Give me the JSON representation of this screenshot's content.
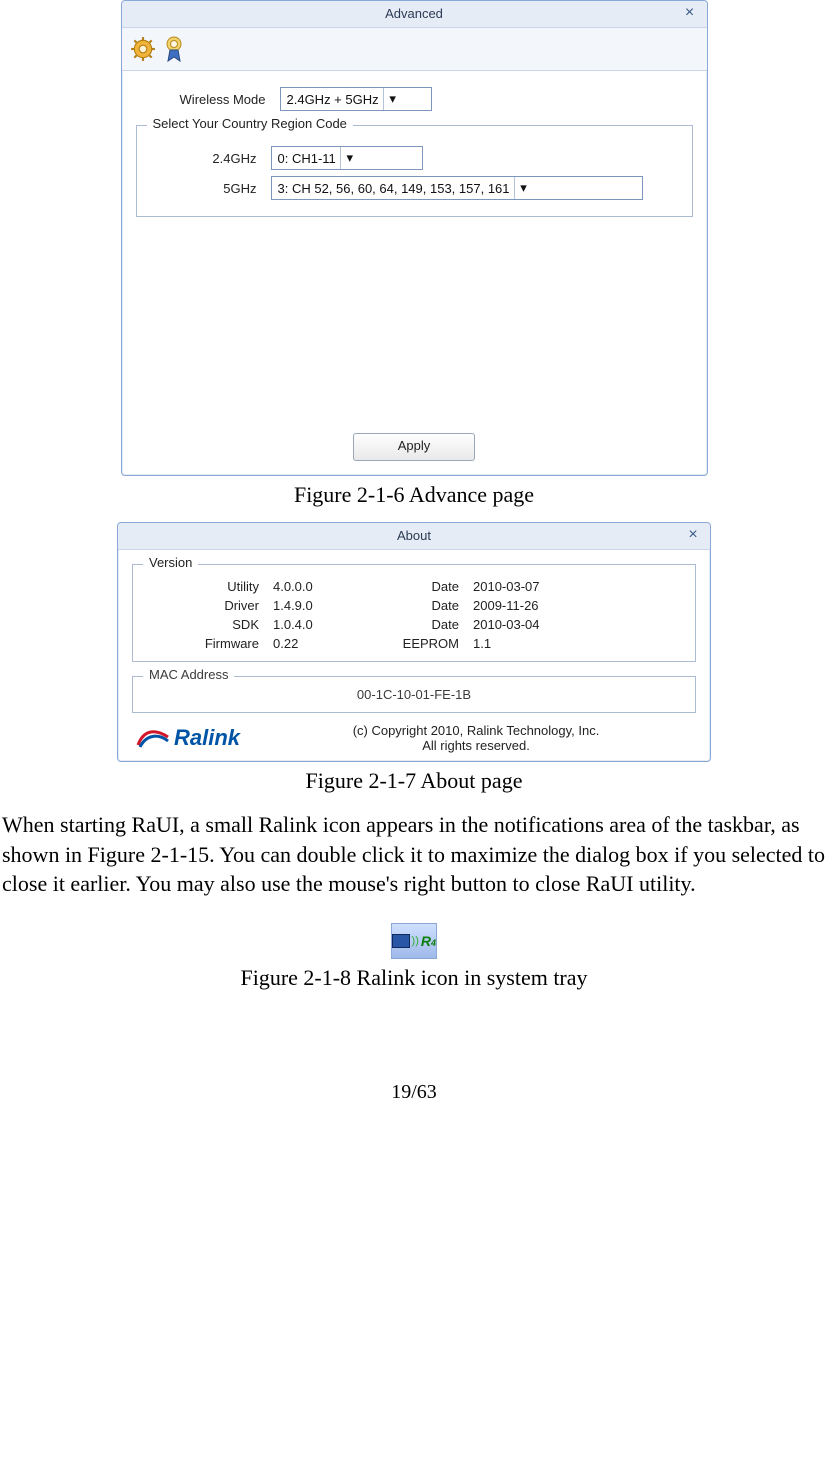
{
  "advanced": {
    "title": "Advanced",
    "wireless_mode_label": "Wireless Mode",
    "wireless_mode_value": "2.4GHz + 5GHz",
    "region_legend": "Select Your Country Region Code",
    "band24_label": "2.4GHz",
    "band24_value": "0: CH1-11",
    "band5_label": "5GHz",
    "band5_value": "3:  CH  52,  56,  60,  64, 149, 153, 157, 161",
    "apply_label": "Apply"
  },
  "fig216_caption": "Figure 2-1-6 Advance page",
  "about": {
    "title": "About",
    "version_legend": "Version",
    "rows": {
      "utility_l": "Utility",
      "utility_v": "4.0.0.0",
      "utility_dl": "Date",
      "utility_dv": "2010-03-07",
      "driver_l": "Driver",
      "driver_v": "1.4.9.0",
      "driver_dl": "Date",
      "driver_dv": "2009-11-26",
      "sdk_l": "SDK",
      "sdk_v": "1.0.4.0",
      "sdk_dl": "Date",
      "sdk_dv": "2010-03-04",
      "fw_l": "Firmware",
      "fw_v": "0.22",
      "fw_dl": "EEPROM",
      "fw_dv": "1.1"
    },
    "mac_legend": "MAC Address",
    "mac_value": "00-1C-10-01-FE-1B",
    "logo_text": "Ralink",
    "copyright1": "(c) Copyright 2010, Ralink Technology, Inc.",
    "copyright2": "All rights reserved."
  },
  "fig217_caption": "Figure 2-1-7 About page",
  "paragraph": "When starting RaUI, a small Ralink icon appears in the notifications area of the taskbar, as shown in Figure 2-1-15. You can double click it to maximize the dialog box if you selected to close it earlier. You may also use the mouse's right button to close RaUI utility.",
  "fig218_caption": "Figure 2-1-8 Ralink icon in system tray",
  "page_number": "19/63"
}
